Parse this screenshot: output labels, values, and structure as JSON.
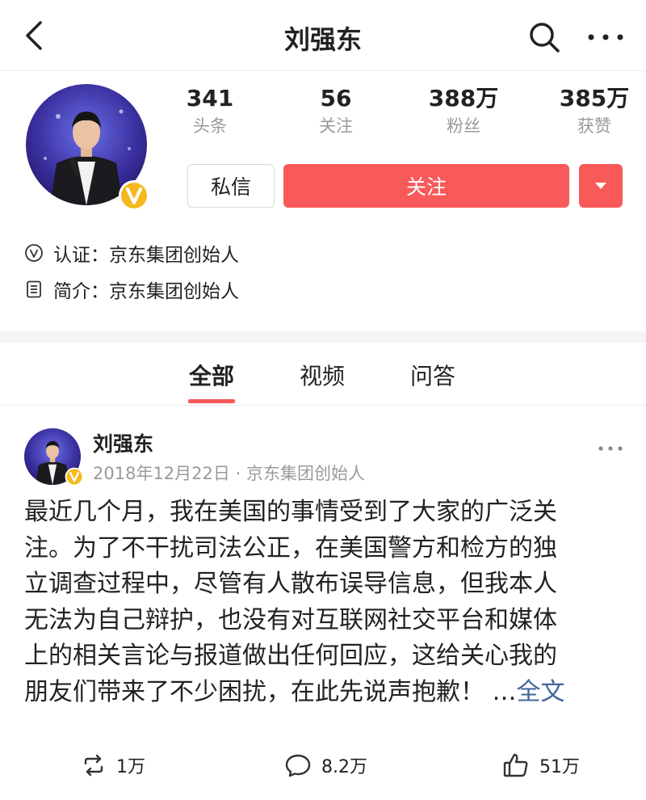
{
  "header": {
    "title": "刘强东"
  },
  "profile": {
    "stats": [
      {
        "value": "341",
        "label": "头条"
      },
      {
        "value": "56",
        "label": "关注"
      },
      {
        "value": "388万",
        "label": "粉丝"
      },
      {
        "value": "385万",
        "label": "获赞"
      }
    ],
    "message_label": "私信",
    "follow_label": "关注",
    "verification_label": "认证：",
    "verification_value": "京东集团创始人",
    "bio_label": "简介：",
    "bio_value": "京东集团创始人"
  },
  "tabs": [
    {
      "label": "全部",
      "active": true
    },
    {
      "label": "视频",
      "active": false
    },
    {
      "label": "问答",
      "active": false
    }
  ],
  "post": {
    "author": "刘强东",
    "date": "2018年12月22日",
    "separator": "·",
    "author_title": "京东集团创始人",
    "lines": [
      "最近几个月，我在美国的事情受到了大家的广泛关",
      "注。为了不干扰司法公正，在美国警方和检方的独",
      "立调查过程中，尽管有人散布误导信息，但我本人",
      "无法为自己辩护，也没有对互联网社交平台和媒体",
      "上的相关言论与报道做出任何回应，这给关心我的",
      "朋友们带来了不少困扰，在此先说声抱歉！ …"
    ],
    "full_text_link": "全文",
    "reposts": "1万",
    "comments": "8.2万",
    "likes": "51万"
  },
  "colors": {
    "accent": "#f85959",
    "verified_badge": "#f5b91e",
    "link": "#406599",
    "muted_text": "#9a9a9a"
  }
}
